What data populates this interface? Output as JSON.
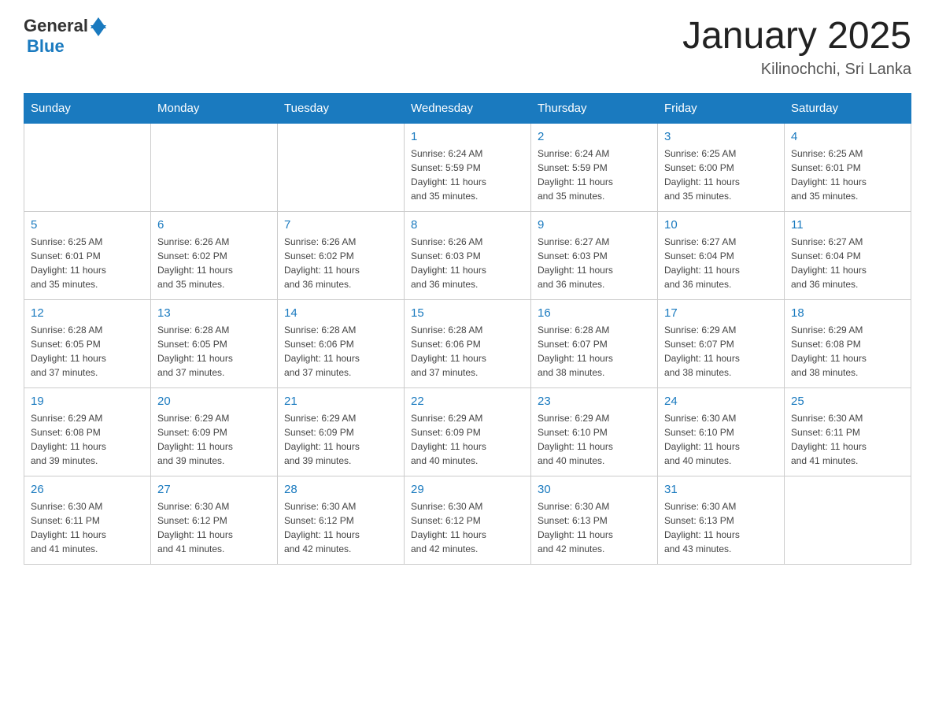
{
  "header": {
    "logo_general": "General",
    "logo_blue": "Blue",
    "title": "January 2025",
    "subtitle": "Kilinochchi, Sri Lanka"
  },
  "days_of_week": [
    "Sunday",
    "Monday",
    "Tuesday",
    "Wednesday",
    "Thursday",
    "Friday",
    "Saturday"
  ],
  "weeks": [
    [
      {
        "day": "",
        "info": ""
      },
      {
        "day": "",
        "info": ""
      },
      {
        "day": "",
        "info": ""
      },
      {
        "day": "1",
        "info": "Sunrise: 6:24 AM\nSunset: 5:59 PM\nDaylight: 11 hours\nand 35 minutes."
      },
      {
        "day": "2",
        "info": "Sunrise: 6:24 AM\nSunset: 5:59 PM\nDaylight: 11 hours\nand 35 minutes."
      },
      {
        "day": "3",
        "info": "Sunrise: 6:25 AM\nSunset: 6:00 PM\nDaylight: 11 hours\nand 35 minutes."
      },
      {
        "day": "4",
        "info": "Sunrise: 6:25 AM\nSunset: 6:01 PM\nDaylight: 11 hours\nand 35 minutes."
      }
    ],
    [
      {
        "day": "5",
        "info": "Sunrise: 6:25 AM\nSunset: 6:01 PM\nDaylight: 11 hours\nand 35 minutes."
      },
      {
        "day": "6",
        "info": "Sunrise: 6:26 AM\nSunset: 6:02 PM\nDaylight: 11 hours\nand 35 minutes."
      },
      {
        "day": "7",
        "info": "Sunrise: 6:26 AM\nSunset: 6:02 PM\nDaylight: 11 hours\nand 36 minutes."
      },
      {
        "day": "8",
        "info": "Sunrise: 6:26 AM\nSunset: 6:03 PM\nDaylight: 11 hours\nand 36 minutes."
      },
      {
        "day": "9",
        "info": "Sunrise: 6:27 AM\nSunset: 6:03 PM\nDaylight: 11 hours\nand 36 minutes."
      },
      {
        "day": "10",
        "info": "Sunrise: 6:27 AM\nSunset: 6:04 PM\nDaylight: 11 hours\nand 36 minutes."
      },
      {
        "day": "11",
        "info": "Sunrise: 6:27 AM\nSunset: 6:04 PM\nDaylight: 11 hours\nand 36 minutes."
      }
    ],
    [
      {
        "day": "12",
        "info": "Sunrise: 6:28 AM\nSunset: 6:05 PM\nDaylight: 11 hours\nand 37 minutes."
      },
      {
        "day": "13",
        "info": "Sunrise: 6:28 AM\nSunset: 6:05 PM\nDaylight: 11 hours\nand 37 minutes."
      },
      {
        "day": "14",
        "info": "Sunrise: 6:28 AM\nSunset: 6:06 PM\nDaylight: 11 hours\nand 37 minutes."
      },
      {
        "day": "15",
        "info": "Sunrise: 6:28 AM\nSunset: 6:06 PM\nDaylight: 11 hours\nand 37 minutes."
      },
      {
        "day": "16",
        "info": "Sunrise: 6:28 AM\nSunset: 6:07 PM\nDaylight: 11 hours\nand 38 minutes."
      },
      {
        "day": "17",
        "info": "Sunrise: 6:29 AM\nSunset: 6:07 PM\nDaylight: 11 hours\nand 38 minutes."
      },
      {
        "day": "18",
        "info": "Sunrise: 6:29 AM\nSunset: 6:08 PM\nDaylight: 11 hours\nand 38 minutes."
      }
    ],
    [
      {
        "day": "19",
        "info": "Sunrise: 6:29 AM\nSunset: 6:08 PM\nDaylight: 11 hours\nand 39 minutes."
      },
      {
        "day": "20",
        "info": "Sunrise: 6:29 AM\nSunset: 6:09 PM\nDaylight: 11 hours\nand 39 minutes."
      },
      {
        "day": "21",
        "info": "Sunrise: 6:29 AM\nSunset: 6:09 PM\nDaylight: 11 hours\nand 39 minutes."
      },
      {
        "day": "22",
        "info": "Sunrise: 6:29 AM\nSunset: 6:09 PM\nDaylight: 11 hours\nand 40 minutes."
      },
      {
        "day": "23",
        "info": "Sunrise: 6:29 AM\nSunset: 6:10 PM\nDaylight: 11 hours\nand 40 minutes."
      },
      {
        "day": "24",
        "info": "Sunrise: 6:30 AM\nSunset: 6:10 PM\nDaylight: 11 hours\nand 40 minutes."
      },
      {
        "day": "25",
        "info": "Sunrise: 6:30 AM\nSunset: 6:11 PM\nDaylight: 11 hours\nand 41 minutes."
      }
    ],
    [
      {
        "day": "26",
        "info": "Sunrise: 6:30 AM\nSunset: 6:11 PM\nDaylight: 11 hours\nand 41 minutes."
      },
      {
        "day": "27",
        "info": "Sunrise: 6:30 AM\nSunset: 6:12 PM\nDaylight: 11 hours\nand 41 minutes."
      },
      {
        "day": "28",
        "info": "Sunrise: 6:30 AM\nSunset: 6:12 PM\nDaylight: 11 hours\nand 42 minutes."
      },
      {
        "day": "29",
        "info": "Sunrise: 6:30 AM\nSunset: 6:12 PM\nDaylight: 11 hours\nand 42 minutes."
      },
      {
        "day": "30",
        "info": "Sunrise: 6:30 AM\nSunset: 6:13 PM\nDaylight: 11 hours\nand 42 minutes."
      },
      {
        "day": "31",
        "info": "Sunrise: 6:30 AM\nSunset: 6:13 PM\nDaylight: 11 hours\nand 43 minutes."
      },
      {
        "day": "",
        "info": ""
      }
    ]
  ]
}
